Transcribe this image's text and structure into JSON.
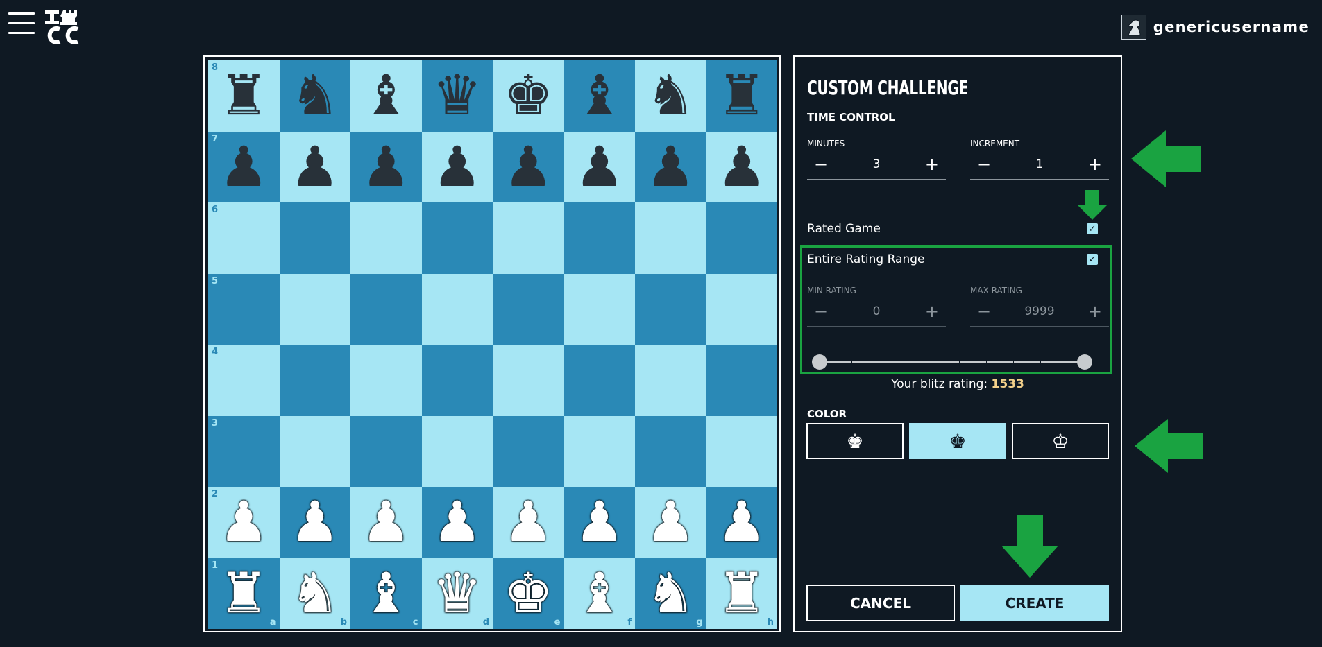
{
  "header": {
    "logo_line1": "I♜",
    "logo_line2": "CC",
    "username": "genericusername",
    "icons": {
      "menu": "hamburger-icon",
      "avatar": "knight-avatar"
    }
  },
  "board": {
    "ranks": [
      "8",
      "7",
      "6",
      "5",
      "4",
      "3",
      "2",
      "1"
    ],
    "files": [
      "a",
      "b",
      "c",
      "d",
      "e",
      "f",
      "g",
      "h"
    ],
    "position": [
      [
        "r",
        "n",
        "b",
        "q",
        "k",
        "b",
        "n",
        "r"
      ],
      [
        "p",
        "p",
        "p",
        "p",
        "p",
        "p",
        "p",
        "p"
      ],
      [
        "",
        "",
        "",
        "",
        "",
        "",
        "",
        ""
      ],
      [
        "",
        "",
        "",
        "",
        "",
        "",
        "",
        ""
      ],
      [
        "",
        "",
        "",
        "",
        "",
        "",
        "",
        ""
      ],
      [
        "",
        "",
        "",
        "",
        "",
        "",
        "",
        ""
      ],
      [
        "P",
        "P",
        "P",
        "P",
        "P",
        "P",
        "P",
        "P"
      ],
      [
        "R",
        "N",
        "B",
        "Q",
        "K",
        "B",
        "N",
        "R"
      ]
    ]
  },
  "panel": {
    "title": "CUSTOM CHALLENGE",
    "time_control_label": "TIME CONTROL",
    "minutes": {
      "label": "MINUTES",
      "value": "3",
      "minus": "−",
      "plus": "+"
    },
    "increment": {
      "label": "INCREMENT",
      "value": "1",
      "minus": "−",
      "plus": "+"
    },
    "rated": {
      "label": "Rated Game",
      "checked": true
    },
    "entire_range": {
      "label": "Entire Rating Range",
      "checked": true
    },
    "min_rating": {
      "label": "MIN RATING",
      "value": "0",
      "minus": "−",
      "plus": "+"
    },
    "max_rating": {
      "label": "MAX RATING",
      "value": "9999",
      "minus": "−",
      "plus": "+"
    },
    "slider": {
      "min": 0,
      "max": 9999,
      "low": 0,
      "high": 9999
    },
    "blitz_rating_prefix": "Your blitz rating:",
    "blitz_rating": "1533",
    "color_label": "COLOR",
    "color_options": [
      {
        "name": "white",
        "glyph": "♚"
      },
      {
        "name": "random",
        "glyph": "♚"
      },
      {
        "name": "black",
        "glyph": "♔"
      }
    ],
    "selected_color": "random",
    "cancel_label": "CANCEL",
    "create_label": "CREATE"
  },
  "colors": {
    "background": "#0f1923",
    "light_square": "#a6e6f4",
    "dark_square": "#2a89b6",
    "accent": "#a6e6f4",
    "annotation_green": "#1aa341",
    "rating_value": "#f3d08a"
  }
}
